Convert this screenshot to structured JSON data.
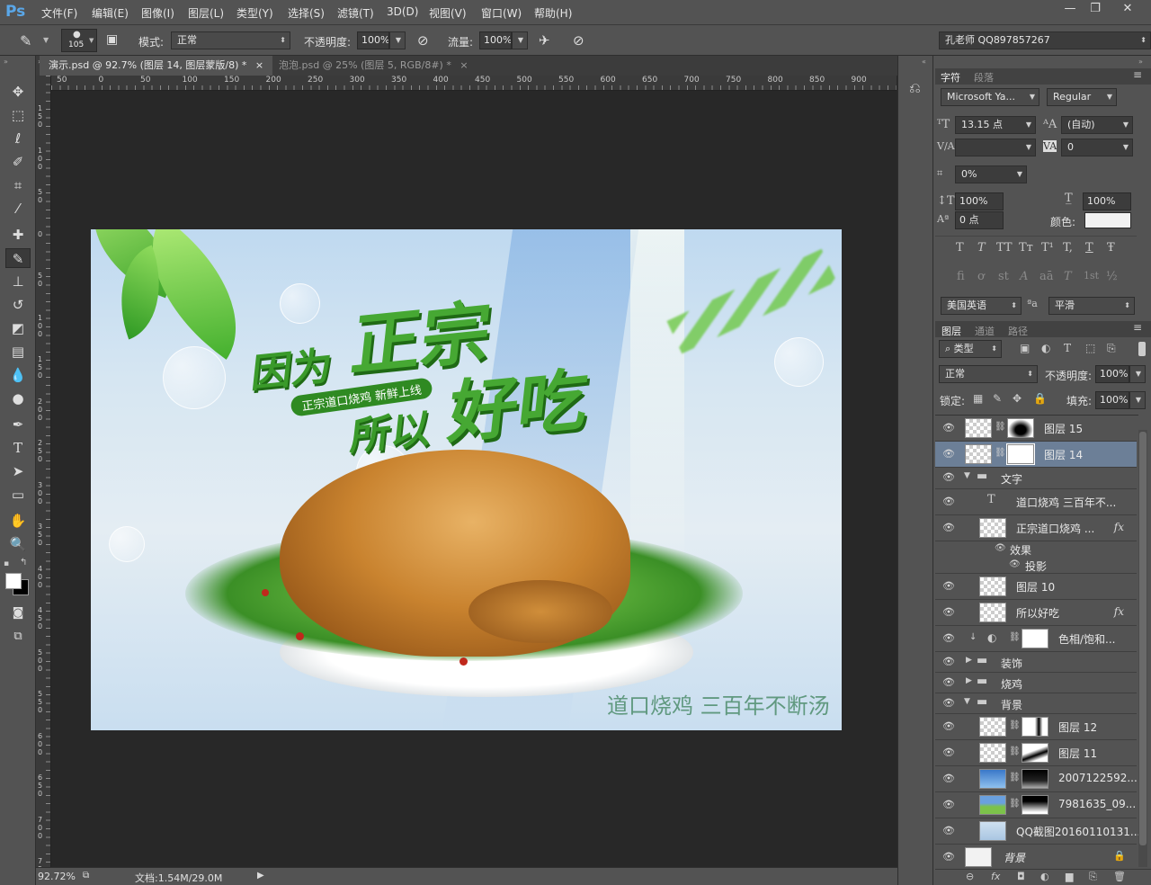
{
  "app": {
    "logo": "Ps"
  },
  "menu": [
    "文件(F)",
    "编辑(E)",
    "图像(I)",
    "图层(L)",
    "类型(Y)",
    "选择(S)",
    "滤镜(T)",
    "3D(D)",
    "视图(V)",
    "窗口(W)",
    "帮助(H)"
  ],
  "window_buttons": [
    "—",
    "❐",
    "✕"
  ],
  "options": {
    "brush_size": "105",
    "mode_label": "模式:",
    "mode_value": "正常",
    "opacity_label": "不透明度:",
    "opacity_value": "100%",
    "flow_label": "流量:",
    "flow_value": "100%",
    "workspace": "孔老师 QQ897857267"
  },
  "tabs": [
    {
      "label": "演示.psd @ 92.7% (图层 14, 图层蒙版/8) *",
      "close": "×",
      "active": true
    },
    {
      "label": "泡泡.psd @ 25% (图层 5, RGB/8#) *",
      "close": "×",
      "active": false
    }
  ],
  "ruler_h": [
    "50",
    "0",
    "50",
    "100",
    "150",
    "200",
    "250",
    "300",
    "350",
    "400",
    "450",
    "500",
    "550",
    "600",
    "650",
    "700",
    "750",
    "800",
    "850",
    "900"
  ],
  "ruler_v": [
    "1 5 0",
    "1 0 0",
    "5 0",
    "0",
    "5 0",
    "1 0 0",
    "1 5 0",
    "2 0 0",
    "2 5 0",
    "3 0 0",
    "3 5 0",
    "4 0 0",
    "4 5 0",
    "5 0 0",
    "5 5 0",
    "6 0 0",
    "6 5 0",
    "7 0 0",
    "7 5 0"
  ],
  "artwork": {
    "line1a": "因为",
    "line1b": "正宗",
    "line2a": "所以",
    "line2b": "好吃",
    "tagline": "正宗道口烧鸡   新鲜上线",
    "bottom": "道口烧鸡 三百年不断汤"
  },
  "status": {
    "zoom": "92.72%",
    "doc": "文档:1.54M/29.0M"
  },
  "character": {
    "tabs": [
      "字符",
      "段落"
    ],
    "font_family": "Microsoft Ya...",
    "font_style": "Regular",
    "size": "13.15 点",
    "leading": "(自动)",
    "kerning": "",
    "tracking": "0",
    "tsume": "0%",
    "vscale": "100%",
    "hscale": "100%",
    "baseline": "0 点",
    "color_label": "颜色:",
    "lang": "美国英语",
    "aa_icon": "ªa",
    "aa": "平滑",
    "style_buttons": [
      "T",
      "T",
      "TT",
      "Tт",
      "T¹",
      "T,",
      "T",
      "Ŧ"
    ],
    "ot_buttons": [
      "fi",
      "ơ",
      "st",
      "A",
      "aā",
      "T",
      "1st",
      "½"
    ]
  },
  "layers_panel": {
    "tabs": [
      "图层",
      "通道",
      "路径"
    ],
    "filter": "类型",
    "blend": "正常",
    "opacity_label": "不透明度:",
    "opacity": "100%",
    "lock_label": "锁定:",
    "fill_label": "填充:",
    "fill": "100%",
    "layers": [
      {
        "name": "图层 15"
      },
      {
        "name": "图层 14"
      },
      {
        "name": "文字"
      },
      {
        "name": "道口烧鸡 三百年不..."
      },
      {
        "name": "正宗道口烧鸡    ..."
      },
      {
        "name": "效果"
      },
      {
        "name": "投影"
      },
      {
        "name": "图层 10"
      },
      {
        "name": "所以好吃"
      },
      {
        "name": "色相/饱和..."
      },
      {
        "name": "装饰"
      },
      {
        "name": "烧鸡"
      },
      {
        "name": "背景"
      },
      {
        "name": "图层 12"
      },
      {
        "name": "图层 11"
      },
      {
        "name": "2007122592..."
      },
      {
        "name": "7981635_09..."
      },
      {
        "name": "QQ截图20160110131..."
      },
      {
        "name": "背景"
      }
    ],
    "fx_label": "fx",
    "bottom_icons": [
      "⊖",
      "fx",
      "◘",
      "◐",
      "▆",
      "⎘",
      "🗑"
    ]
  },
  "colors": {
    "accent": "#5aa7e8",
    "selected_row": "#6c7f97",
    "green_text": "#3a9a2a"
  }
}
